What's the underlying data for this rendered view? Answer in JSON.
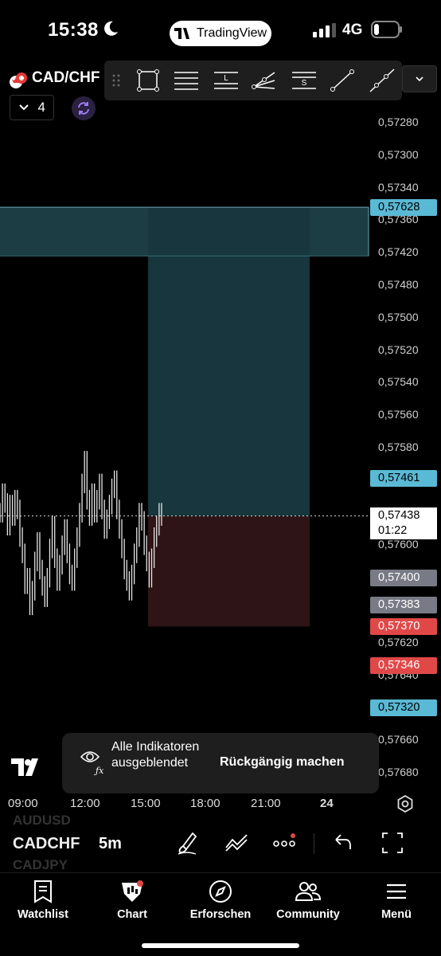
{
  "status_bar": {
    "time": "15:38",
    "network": "4G",
    "app_pill": "TradingView"
  },
  "header": {
    "symbol": "CAD/CHF",
    "tools_count": "4"
  },
  "drawing_toolbar": {
    "tools": [
      "rectangle-icon",
      "horizontal-lines-icon",
      "long-position-icon",
      "trend-fan-icon",
      "short-position-icon",
      "trend-line-icon",
      "ray-icon"
    ]
  },
  "price_axis": {
    "ticks": [
      "0,57680",
      "0,57660",
      "0,57640",
      "0,57620",
      "0,57600",
      "0,57580",
      "0,57560",
      "0,57540",
      "0,57520",
      "0,57500",
      "0,57480",
      "0,57420",
      "0,57360",
      "0,57340",
      "0,57300",
      "0,57280"
    ],
    "badges": [
      {
        "label": "0,57628",
        "color": "#5ab9d4",
        "text_color": "#000000"
      },
      {
        "label": "0,57461",
        "color": "#5ab9d4",
        "text_color": "#000000"
      },
      {
        "label": "0,57438",
        "color": "#787b86",
        "text_color": "#ffffff"
      },
      {
        "label": "0,57400",
        "color": "#787b86",
        "text_color": "#ffffff"
      },
      {
        "label": "0,57383",
        "color": "#787b86",
        "text_color": "#ffffff"
      },
      {
        "label": "0,57370",
        "color": "#e04848",
        "text_color": "#ffffff"
      },
      {
        "label": "0,57346",
        "color": "#e04848",
        "text_color": "#ffffff"
      },
      {
        "label": "0,57320",
        "color": "#5ab9d4",
        "text_color": "#000000"
      }
    ],
    "current_price": "0,57438",
    "countdown": "01:22"
  },
  "chart_data": {
    "type": "candlestick",
    "interval": "5m",
    "x_ticks": [
      "09:00",
      "12:00",
      "15:00",
      "18:00",
      "21:00",
      "24"
    ],
    "y_ticks": [
      0.5728,
      0.573,
      0.5734,
      0.5736,
      0.5742,
      0.5748,
      0.575,
      0.5752,
      0.5754,
      0.5756,
      0.5758,
      0.576,
      0.5762,
      0.5764,
      0.5766,
      0.5768
    ],
    "current_price": 0.57438,
    "zones": [
      {
        "kind": "resistance",
        "from": 0.57598,
        "to": 0.57628,
        "color": "#1d3d44"
      },
      {
        "kind": "target",
        "from": 0.57438,
        "to": 0.57628,
        "color": "#17363d"
      },
      {
        "kind": "stop",
        "from": 0.5737,
        "to": 0.57438,
        "color": "#2e1417"
      }
    ],
    "series": [
      {
        "values": [
          0.5744,
          0.57452,
          0.57446,
          0.57432,
          0.57445,
          0.57438,
          0.57448,
          0.57442,
          0.57425,
          0.57415,
          0.57396,
          0.574,
          0.57383,
          0.57392,
          0.5741,
          0.57422,
          0.57405,
          0.57395,
          0.57388,
          0.574,
          0.57418,
          0.57432,
          0.57412,
          0.57398,
          0.57408,
          0.5742,
          0.5743,
          0.57415,
          0.57402,
          0.57398,
          0.57412,
          0.57425,
          0.5744,
          0.57458,
          0.57472,
          0.57448,
          0.57438,
          0.57452,
          0.5744,
          0.57448,
          0.57458,
          0.57442,
          0.5743,
          0.57436,
          0.57445,
          0.57455,
          0.5746,
          0.57442,
          0.5743,
          0.57418,
          0.57405,
          0.57398,
          0.57392,
          0.57402,
          0.57415,
          0.57425,
          0.5744,
          0.57435,
          0.5742,
          0.5741,
          0.574,
          0.57412,
          0.57425,
          0.57432,
          0.5744,
          0.57438
        ]
      }
    ]
  },
  "toast": {
    "message": "Alle Indikatoren ausgeblendet",
    "action": "Rückgängig machen"
  },
  "bottom_toolbar": {
    "symbol": "CADCHF",
    "interval": "5m",
    "ghost_above": "AUDUSD",
    "ghost_below": "CADJPY"
  },
  "nav": [
    {
      "label": "Watchlist",
      "icon": "watchlist-icon"
    },
    {
      "label": "Chart",
      "icon": "chart-icon"
    },
    {
      "label": "Erforschen",
      "icon": "compass-icon"
    },
    {
      "label": "Community",
      "icon": "community-icon"
    },
    {
      "label": "Menü",
      "icon": "menu-icon"
    }
  ]
}
